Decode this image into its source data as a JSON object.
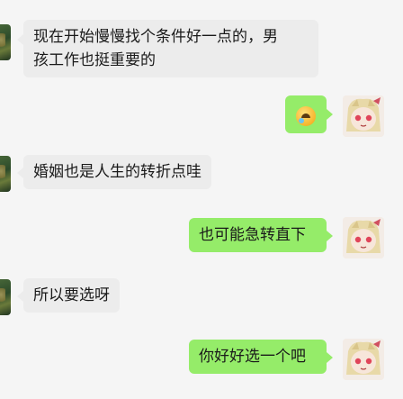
{
  "messages": [
    {
      "side": "in",
      "lines": [
        "现在开始慢慢找个条件好一点的，男",
        "孩工作也挺重要的"
      ]
    },
    {
      "side": "out",
      "emoji": "laughing-tears-emoji"
    },
    {
      "side": "in",
      "lines": [
        "婚姻也是人生的转折点哇"
      ]
    },
    {
      "side": "out",
      "lines": [
        "也可能急转直下"
      ]
    },
    {
      "side": "in",
      "lines": [
        "所以要选呀"
      ]
    },
    {
      "side": "out",
      "lines": [
        "你好好选一个吧"
      ]
    }
  ],
  "colors": {
    "background": "#f5f5f5",
    "incoming_bubble": "#ececec",
    "outgoing_bubble": "#95ec69"
  }
}
